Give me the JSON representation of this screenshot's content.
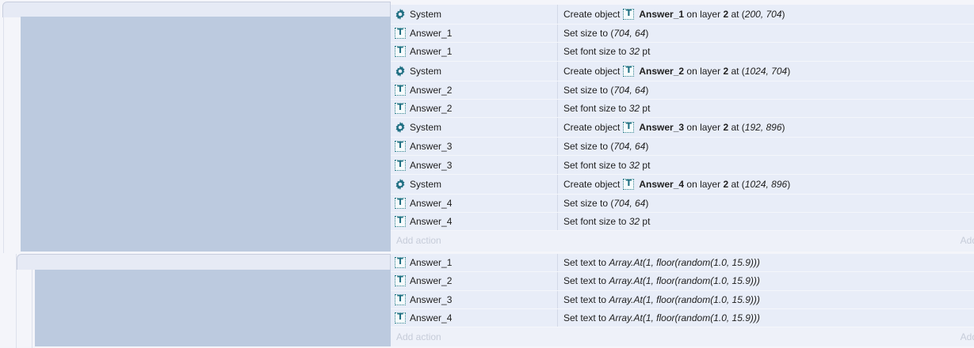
{
  "colors": {
    "condition_panel": "#bccadf",
    "action_row": "#e8edf8",
    "icon_teal": "#1f6f82"
  },
  "events": [
    {
      "actions": [
        {
          "icon": "gear-icon",
          "object": "System",
          "parts": [
            [
              "Create object",
              ""
            ],
            [
              "__icon__",
              ""
            ],
            [
              "Answer_1",
              "b"
            ],
            [
              " on layer ",
              ""
            ],
            [
              "2",
              "b"
            ],
            [
              " at (",
              ""
            ],
            [
              "200, 704",
              "i"
            ],
            [
              ")",
              ""
            ]
          ]
        },
        {
          "icon": "text-object-icon",
          "object": "Answer_1",
          "parts": [
            [
              "Set size to (",
              ""
            ],
            [
              "704, 64",
              "i"
            ],
            [
              ")",
              ""
            ]
          ]
        },
        {
          "icon": "text-object-icon",
          "object": "Answer_1",
          "parts": [
            [
              "Set font size to ",
              ""
            ],
            [
              "32",
              "i"
            ],
            [
              " pt",
              ""
            ]
          ]
        },
        {
          "icon": "gear-icon",
          "object": "System",
          "parts": [
            [
              "Create object",
              ""
            ],
            [
              "__icon__",
              ""
            ],
            [
              "Answer_2",
              "b"
            ],
            [
              " on layer ",
              ""
            ],
            [
              "2",
              "b"
            ],
            [
              " at (",
              ""
            ],
            [
              "1024, 704",
              "i"
            ],
            [
              ")",
              ""
            ]
          ]
        },
        {
          "icon": "text-object-icon",
          "object": "Answer_2",
          "parts": [
            [
              "Set size to (",
              ""
            ],
            [
              "704, 64",
              "i"
            ],
            [
              ")",
              ""
            ]
          ]
        },
        {
          "icon": "text-object-icon",
          "object": "Answer_2",
          "parts": [
            [
              "Set font size to ",
              ""
            ],
            [
              "32",
              "i"
            ],
            [
              " pt",
              ""
            ]
          ]
        },
        {
          "icon": "gear-icon",
          "object": "System",
          "parts": [
            [
              "Create object",
              ""
            ],
            [
              "__icon__",
              ""
            ],
            [
              "Answer_3",
              "b"
            ],
            [
              " on layer ",
              ""
            ],
            [
              "2",
              "b"
            ],
            [
              " at (",
              ""
            ],
            [
              "192, 896",
              "i"
            ],
            [
              ")",
              ""
            ]
          ]
        },
        {
          "icon": "text-object-icon",
          "object": "Answer_3",
          "parts": [
            [
              "Set size to (",
              ""
            ],
            [
              "704, 64",
              "i"
            ],
            [
              ")",
              ""
            ]
          ]
        },
        {
          "icon": "text-object-icon",
          "object": "Answer_3",
          "parts": [
            [
              "Set font size to ",
              ""
            ],
            [
              "32",
              "i"
            ],
            [
              " pt",
              ""
            ]
          ]
        },
        {
          "icon": "gear-icon",
          "object": "System",
          "parts": [
            [
              "Create object",
              ""
            ],
            [
              "__icon__",
              ""
            ],
            [
              "Answer_4",
              "b"
            ],
            [
              " on layer ",
              ""
            ],
            [
              "2",
              "b"
            ],
            [
              " at (",
              ""
            ],
            [
              "1024, 896",
              "i"
            ],
            [
              ")",
              ""
            ]
          ]
        },
        {
          "icon": "text-object-icon",
          "object": "Answer_4",
          "parts": [
            [
              "Set size to (",
              ""
            ],
            [
              "704, 64",
              "i"
            ],
            [
              ")",
              ""
            ]
          ]
        },
        {
          "icon": "text-object-icon",
          "object": "Answer_4",
          "parts": [
            [
              "Set font size to ",
              ""
            ],
            [
              "32",
              "i"
            ],
            [
              " pt",
              ""
            ]
          ]
        }
      ],
      "add_action_label": "Add action",
      "add_action_right": "Add"
    },
    {
      "actions": [
        {
          "icon": "text-object-icon",
          "object": "Answer_1",
          "parts": [
            [
              "Set text to ",
              ""
            ],
            [
              "Array.At(1, floor(random(1.0, 15.9)))",
              "i"
            ]
          ]
        },
        {
          "icon": "text-object-icon",
          "object": "Answer_2",
          "parts": [
            [
              "Set text to ",
              ""
            ],
            [
              "Array.At(1, floor(random(1.0, 15.9)))",
              "i"
            ]
          ]
        },
        {
          "icon": "text-object-icon",
          "object": "Answer_3",
          "parts": [
            [
              "Set text to ",
              ""
            ],
            [
              "Array.At(1, floor(random(1.0, 15.9)))",
              "i"
            ]
          ]
        },
        {
          "icon": "text-object-icon",
          "object": "Answer_4",
          "parts": [
            [
              "Set text to ",
              ""
            ],
            [
              "Array.At(1, floor(random(1.0, 15.9)))",
              "i"
            ]
          ]
        }
      ],
      "add_action_label": "Add action",
      "add_action_right": "Add"
    }
  ]
}
